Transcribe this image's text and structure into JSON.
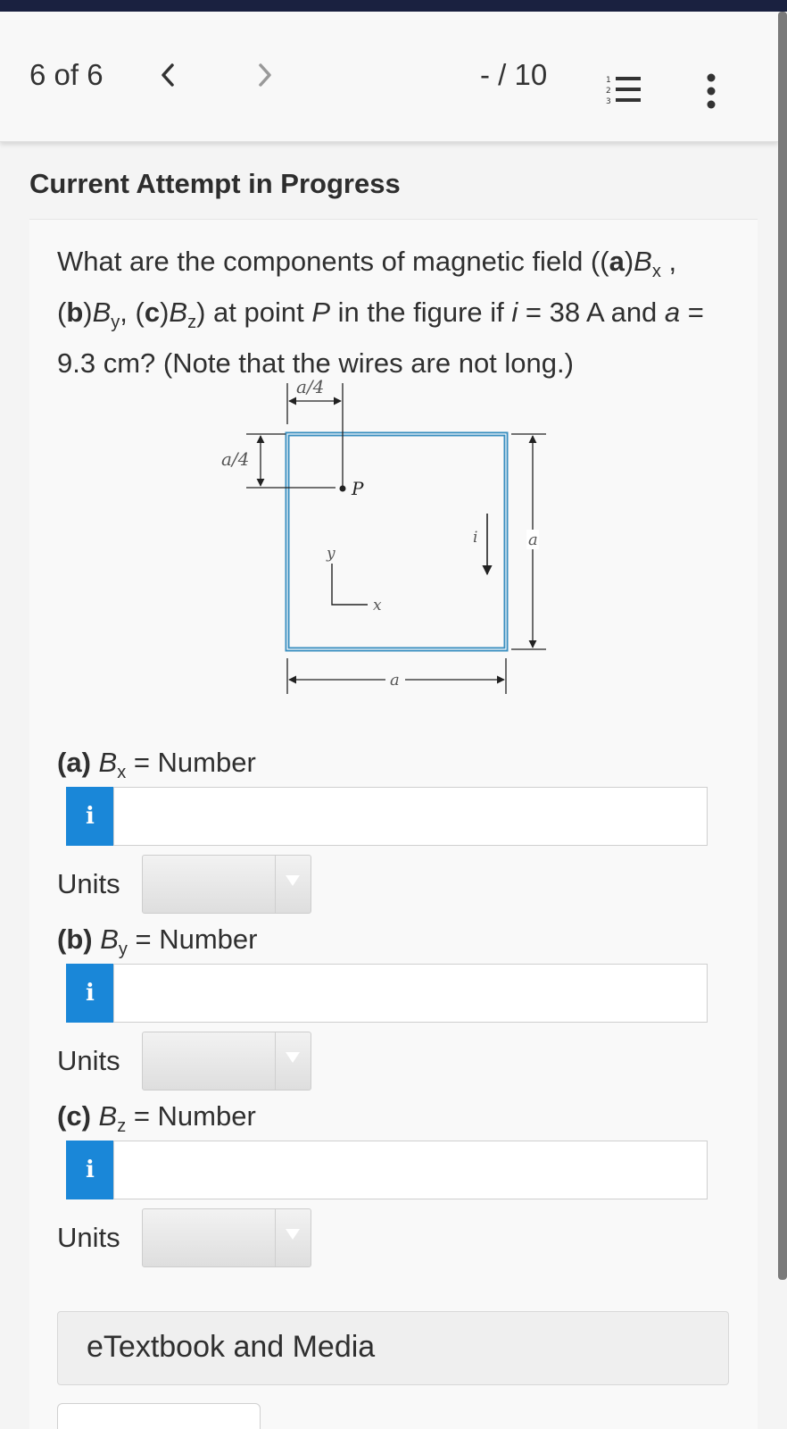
{
  "nav": {
    "position": "6 of 6",
    "prev_icon": "chevron-left-icon",
    "next_icon": "chevron-right-icon",
    "score": "- / 10",
    "list_icon": "numbered-list-icon",
    "more_icon": "vertical-ellipsis-icon"
  },
  "attempt_title": "Current Attempt in Progress",
  "question": {
    "t1": "What are the components of magnetic field ((",
    "a_tag": "a",
    "t2": ")",
    "bx": "B",
    "bx_sub": "x",
    "t3": " , ",
    "t4": "(",
    "b_tag": "b",
    "t5": ")",
    "by": "B",
    "by_sub": "y",
    "t6": ", (",
    "c_tag": "c",
    "t7": ")",
    "bz": "B",
    "bz_sub": "z",
    "t8": ") at point ",
    "p": "P",
    "t9": " in the figure if ",
    "i": "i",
    "t10": " = 38 A and ",
    "a_var": "a",
    "t11": " = 9.3 cm? (Note that the wires are not long.)"
  },
  "figure": {
    "dim_top": "a/4",
    "dim_left": "a/4",
    "point_label": "P",
    "current_label": "i",
    "right_dim": "a",
    "bottom_dim": "a",
    "axis_y": "y",
    "axis_x": "x",
    "wire_color": "#3a8fc0"
  },
  "parts": [
    {
      "tag": "(a)",
      "var": "B",
      "sub": "x",
      "rest": " = Number",
      "units_label": "Units",
      "info": "i",
      "value": ""
    },
    {
      "tag": "(b)",
      "var": "B",
      "sub": "y",
      "rest": " = Number",
      "units_label": "Units",
      "info": "i",
      "value": ""
    },
    {
      "tag": "(c)",
      "var": "B",
      "sub": "z",
      "rest": " = Number",
      "units_label": "Units",
      "info": "i",
      "value": ""
    }
  ],
  "etextbook": "eTextbook and Media",
  "colors": {
    "accent": "#1a87d8",
    "topbar": "#1a2140"
  }
}
